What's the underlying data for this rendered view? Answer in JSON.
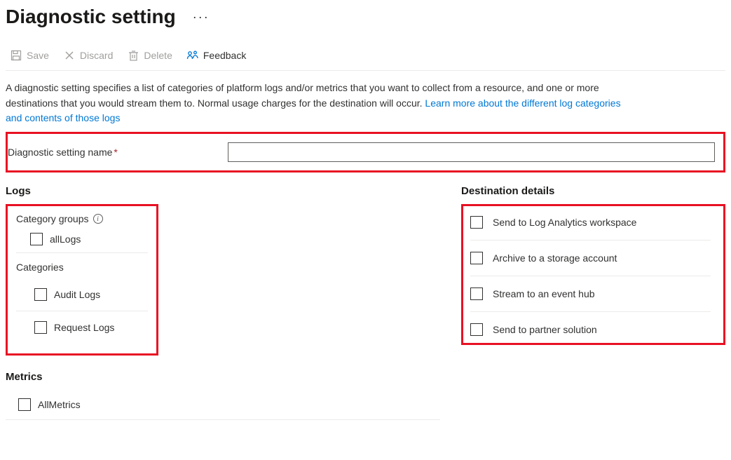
{
  "header": {
    "title": "Diagnostic setting"
  },
  "toolbar": {
    "save": "Save",
    "discard": "Discard",
    "delete": "Delete",
    "feedback": "Feedback"
  },
  "description": {
    "text_a": "A diagnostic setting specifies a list of categories of platform logs and/or metrics that you want to collect from a resource, and one or more destinations that you would stream them to. Normal usage charges for the destination will occur. ",
    "link": "Learn more about the different log categories and contents of those logs"
  },
  "name_field": {
    "label": "Diagnostic setting name",
    "value": ""
  },
  "logs": {
    "title": "Logs",
    "category_groups_label": "Category groups",
    "group_all": "allLogs",
    "categories_label": "Categories",
    "cat_audit": "Audit Logs",
    "cat_request": "Request Logs"
  },
  "destinations": {
    "title": "Destination details",
    "law": "Send to Log Analytics workspace",
    "storage": "Archive to a storage account",
    "eventhub": "Stream to an event hub",
    "partner": "Send to partner solution"
  },
  "metrics": {
    "title": "Metrics",
    "all": "AllMetrics"
  }
}
